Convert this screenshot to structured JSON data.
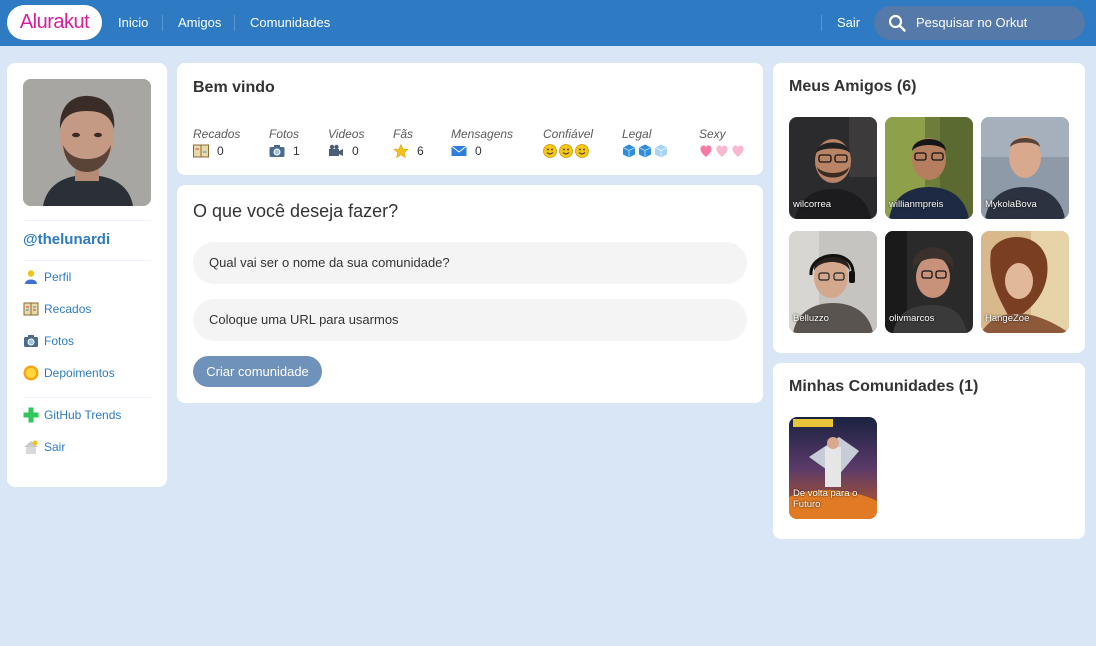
{
  "topbar": {
    "logo": "Alurakut",
    "links": [
      "Inicio",
      "Amigos",
      "Comunidades"
    ],
    "logout": "Sair",
    "search_placeholder": "Pesquisar no Orkut"
  },
  "profile": {
    "username": "@thelunardi",
    "menu": [
      {
        "label": "Perfil",
        "icon": "user-icon"
      },
      {
        "label": "Recados",
        "icon": "book-icon"
      },
      {
        "label": "Fotos",
        "icon": "camera-icon"
      },
      {
        "label": "Depoimentos",
        "icon": "sun-icon"
      }
    ],
    "menu2": [
      {
        "label": "GitHub Trends",
        "icon": "plus-icon"
      },
      {
        "label": "Sair",
        "icon": "home-icon"
      }
    ]
  },
  "welcome": {
    "title": "Bem vindo",
    "stats": [
      {
        "label": "Recados",
        "value": "0",
        "icon": "book-icon"
      },
      {
        "label": "Fotos",
        "value": "1",
        "icon": "camera-icon"
      },
      {
        "label": "Videos",
        "value": "0",
        "icon": "video-camera-icon"
      },
      {
        "label": "Fãs",
        "value": "6",
        "icon": "star-icon"
      },
      {
        "label": "Mensagens",
        "value": "0",
        "icon": "envelope-icon"
      }
    ],
    "ratings": [
      {
        "label": "Confiável",
        "icon": "smiley-icon",
        "level": 3
      },
      {
        "label": "Legal",
        "icon": "ice-cube-icon",
        "level": 2
      },
      {
        "label": "Sexy",
        "icon": "heart-icon",
        "level": 1
      }
    ],
    "rating_colors": {
      "smiley": "#F6C619",
      "cube": "#2F8DDC",
      "heart": "#F57CA0"
    }
  },
  "action": {
    "title": "O que você deseja fazer?",
    "name_placeholder": "Qual vai ser o nome da sua comunidade?",
    "url_placeholder": "Coloque uma URL para usarmos",
    "submit": "Criar comunidade"
  },
  "friends": {
    "title": "Meus Amigos (6)",
    "items": [
      "wilcorrea",
      "willianmpreis",
      "MykolaBova",
      "Belluzzo",
      "olivmarcos",
      "HangeZoe"
    ]
  },
  "communities": {
    "title": "Minhas Comunidades (1)",
    "items": [
      "De volta para o Futuro"
    ]
  },
  "colors": {
    "topbar": "#2E7BC4",
    "background": "#D9E6F6",
    "accent": "#2E7BC4",
    "logo": "#D81D99"
  }
}
